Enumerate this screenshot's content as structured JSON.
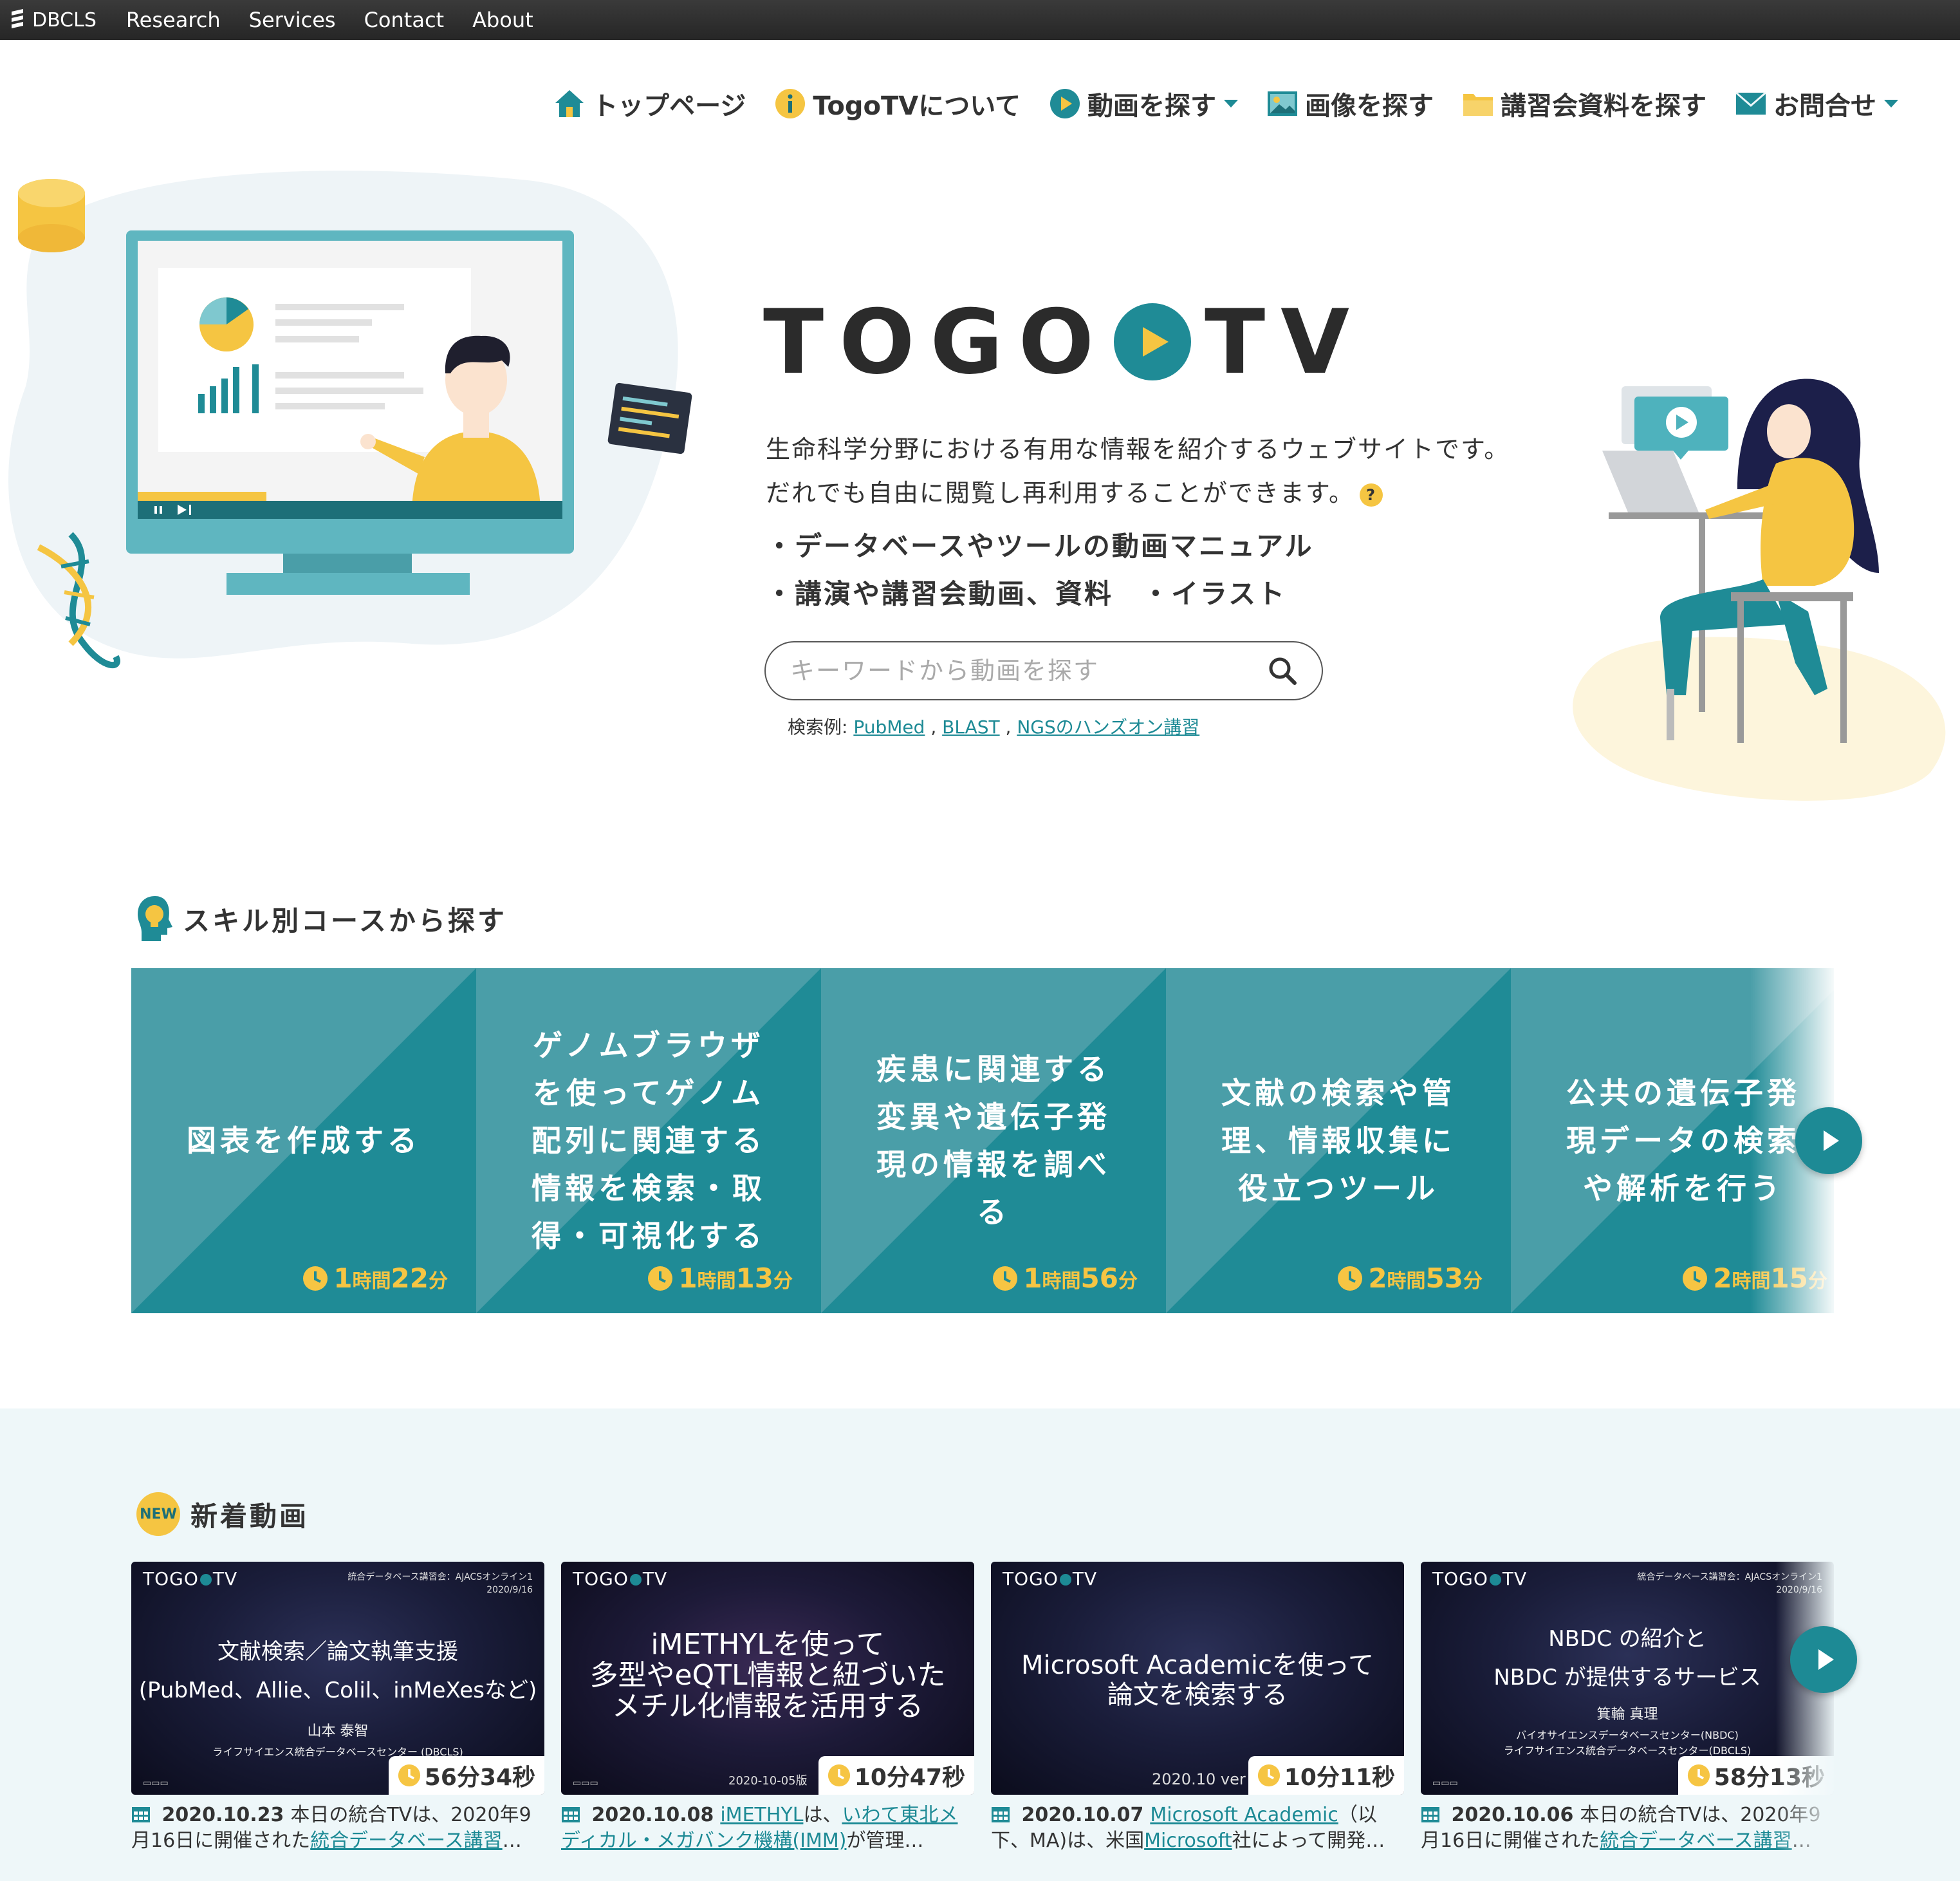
{
  "topbar": {
    "brand": "DBCLS",
    "links": [
      "Research",
      "Services",
      "Contact",
      "About"
    ]
  },
  "nav": {
    "items": [
      {
        "label": "トップページ",
        "icon": "home-icon"
      },
      {
        "label": "TogoTVについて",
        "icon": "info-icon"
      },
      {
        "label": "動画を探す",
        "icon": "play-circle-icon",
        "dropdown": true
      },
      {
        "label": "画像を探す",
        "icon": "image-icon"
      },
      {
        "label": "講習会資料を探す",
        "icon": "folder-icon"
      },
      {
        "label": "お問合せ",
        "icon": "mail-icon",
        "dropdown": true
      }
    ]
  },
  "hero": {
    "logo_left": "TOGO",
    "logo_right": "TV",
    "description_line1": "生命科学分野における有用な情報を紹介するウェブサイトです。",
    "description_line2": "だれでも自由に閲覧し再利用することができます。",
    "help_icon": "?",
    "bullet1": "・データベースやツールの動画マニュアル",
    "bullet2": "・講演や講習会動画、資料　・イラスト",
    "search_placeholder": "キーワードから動画を探す",
    "examples_label": "検索例:",
    "examples": [
      "PubMed",
      "BLAST",
      "NGSのハンズオン講習"
    ],
    "examples_sep": ","
  },
  "skills": {
    "title": "スキル別コースから探す",
    "courses": [
      {
        "title": "図表を作成する",
        "hours": "1",
        "hours_unit": "時間",
        "minutes": "22",
        "minutes_unit": "分"
      },
      {
        "title": "ゲノムブラウザを使ってゲノム配列に関連する情報を検索・取得・可視化する",
        "hours": "1",
        "hours_unit": "時間",
        "minutes": "13",
        "minutes_unit": "分"
      },
      {
        "title": "疾患に関連する変異や遺伝子発現の情報を調べる",
        "hours": "1",
        "hours_unit": "時間",
        "minutes": "56",
        "minutes_unit": "分"
      },
      {
        "title": "文献の検索や管理、情報収集に役立つツール",
        "hours": "2",
        "hours_unit": "時間",
        "minutes": "53",
        "minutes_unit": "分"
      },
      {
        "title": "公共の遺伝子発現データの検索や解析を行う",
        "hours": "2",
        "hours_unit": "時間",
        "minutes": "15",
        "minutes_unit": "分"
      }
    ]
  },
  "new_videos": {
    "badge": "NEW",
    "title": "新着動画",
    "items": [
      {
        "thumb_logo_left": "TOGO",
        "thumb_logo_right": "TV",
        "thumb_info1": "統合データベース講習会：AJACSオンライン1",
        "thumb_info2": "2020/9/16",
        "thumb_line1": "文献検索／論文執筆支援",
        "thumb_line2": "(PubMed、Allie、Colil、inMeXesなど)",
        "thumb_sub1": "山本 泰智",
        "thumb_sub2": "ライフサイエンス統合データベースセンター (DBCLS)",
        "thumb_date": "",
        "duration": "56分34秒",
        "date": "2020.10.23",
        "text_before": "本日の統合TVは、2020年9月16日に開催された",
        "link1": "統合データベース講習",
        "text_mid": "",
        "link2": "",
        "text_after": "…"
      },
      {
        "thumb_logo_left": "TOGO",
        "thumb_logo_right": "TV",
        "thumb_info1": "",
        "thumb_info2": "",
        "thumb_line1": "iMETHYLを使って",
        "thumb_line2": "多型やeQTL情報と紐づいた",
        "thumb_line3": "メチル化情報を活用する",
        "thumb_date": "2020-10-05版",
        "duration": "10分47秒",
        "date": "2020.10.08",
        "text_before": "",
        "link1": "iMETHYL",
        "text_mid": "は、",
        "link2": "いわて東北メディカル・メガバンク機構(IMM)",
        "text_after": "が管理…"
      },
      {
        "thumb_logo_left": "TOGO",
        "thumb_logo_right": "TV",
        "thumb_info1": "",
        "thumb_info2": "",
        "thumb_line1": "Microsoft Academicを使って",
        "thumb_line2": "論文を検索する",
        "thumb_date": "2020.10 ver",
        "duration": "10分11秒",
        "date": "2020.10.07",
        "text_before": "",
        "link1": "Microsoft Academic",
        "text_mid": "（以下、MA)は、米国",
        "link2": "Microsoft",
        "text_after": "社によって開発…"
      },
      {
        "thumb_logo_left": "TOGO",
        "thumb_logo_right": "TV",
        "thumb_info1": "統合データベース講習会：AJACSオンライン1",
        "thumb_info2": "2020/9/16",
        "thumb_line1": "NBDC の紹介と",
        "thumb_line2": "NBDC が提供するサービス",
        "thumb_sub1": "箕輪 真理",
        "thumb_sub2": "バイオサイエンスデータベースセンター(NBDC)",
        "thumb_sub3": "ライフサイエンス統合データベースセンター(DBCLS)",
        "thumb_date": "",
        "duration": "58分13秒",
        "date": "2020.10.06",
        "text_before": "本日の統合TVは、2020年9月16日に開催された",
        "link1": "統合データベース講習",
        "text_mid": "",
        "link2": "",
        "text_after": "…"
      }
    ]
  },
  "colors": {
    "teal": "#1f8b96",
    "teal_dark": "#1d6f78",
    "yellow": "#f5c542",
    "new_bg": "#eef7f9",
    "topbar": "#2b2b2b"
  }
}
